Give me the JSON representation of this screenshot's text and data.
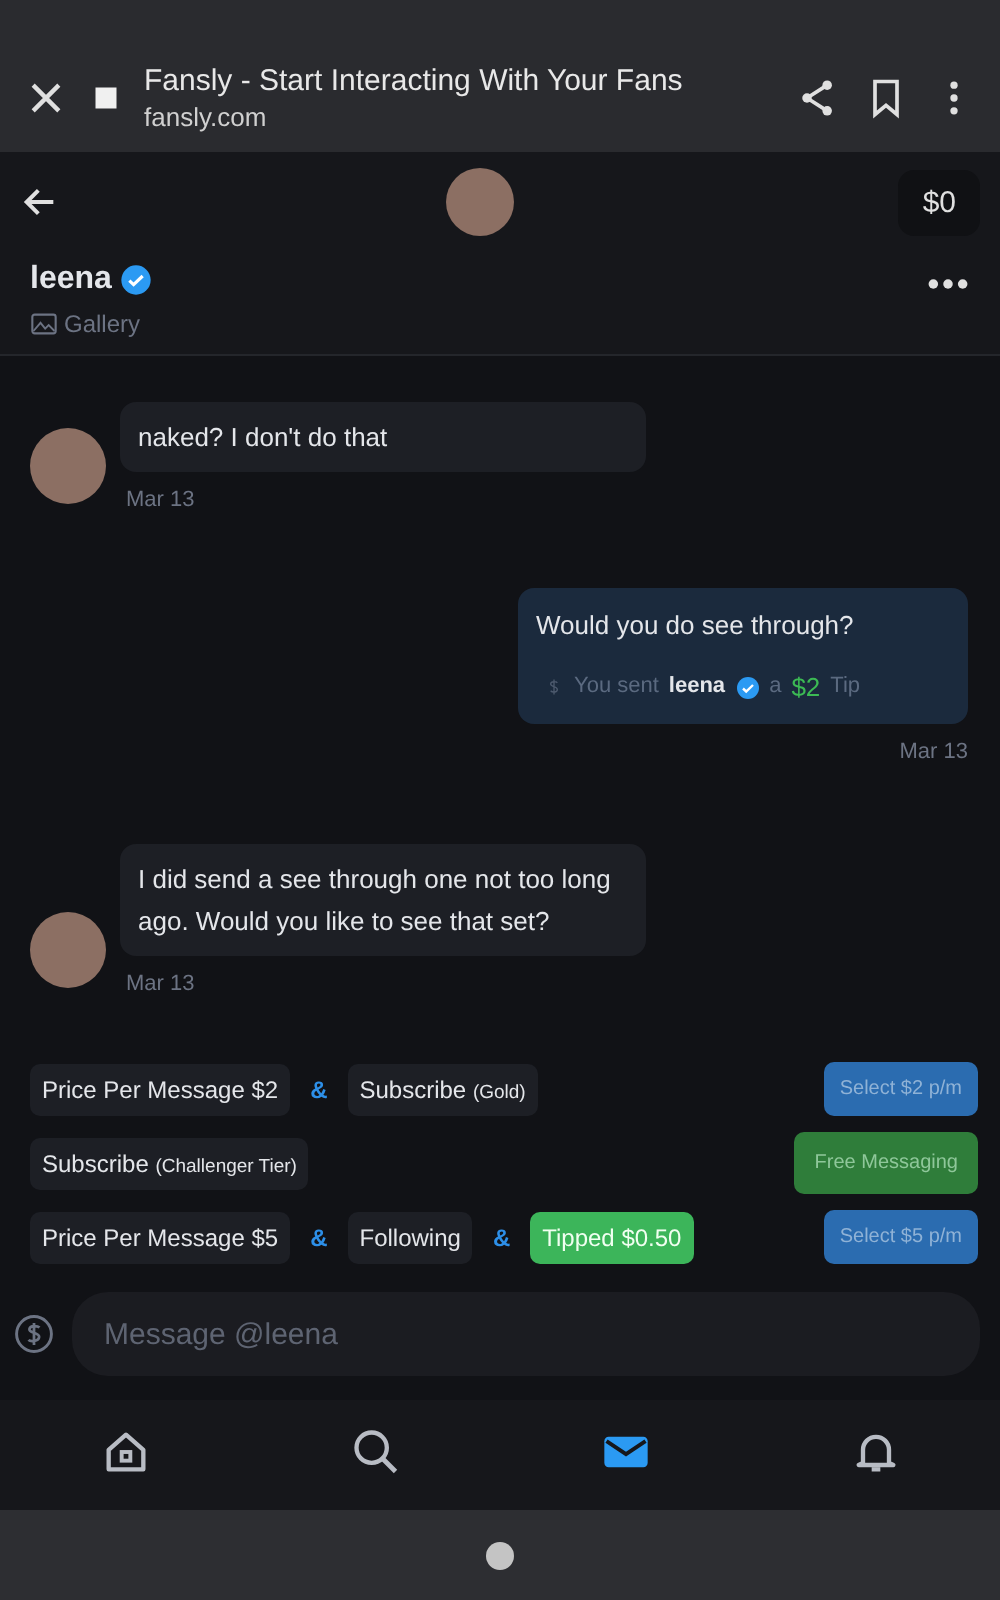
{
  "browser": {
    "title": "Fansly - Start Interacting With Your Fans",
    "url": "fansly.com"
  },
  "header": {
    "balance": "$0",
    "name": "leena",
    "verified": true,
    "gallery": "Gallery"
  },
  "messages": [
    {
      "kind": "incoming",
      "text": "naked? I don't do that",
      "date": "Mar 13"
    },
    {
      "kind": "outgoing",
      "text": "Would you do see through?",
      "tip": {
        "prefix": "You sent",
        "recipient": "leena",
        "joiner": "a",
        "amount": "$2",
        "suffix": "Tip"
      },
      "date": "Mar 13"
    },
    {
      "kind": "incoming",
      "text": "I did send a see through one not too long ago. Would you like to see that set?",
      "date": "Mar 13"
    }
  ],
  "tiers": [
    {
      "items": [
        {
          "kind": "chip",
          "label": "Price Per Message $2"
        },
        {
          "kind": "joiner",
          "label": "&"
        },
        {
          "kind": "chip",
          "label": "Subscribe",
          "note": "(Gold)"
        }
      ],
      "action": {
        "label": "Select $2 p/m",
        "color": "#2b6cb0"
      }
    },
    {
      "items": [
        {
          "kind": "chip",
          "label": "Subscribe",
          "note": "(Challenger Tier)"
        }
      ],
      "action": {
        "label": "Free Messaging",
        "color": "#2f7d3a"
      }
    },
    {
      "items": [
        {
          "kind": "chip",
          "label": "Price Per Message $5"
        },
        {
          "kind": "joiner",
          "label": "&"
        },
        {
          "kind": "chip",
          "label": "Following"
        },
        {
          "kind": "joiner",
          "label": "&"
        },
        {
          "kind": "highlight",
          "label": "Tipped $0.50"
        }
      ],
      "action": {
        "label": "Select $5 p/m",
        "color": "#2b6cb0"
      }
    }
  ],
  "composer": {
    "placeholder": "Message @leena"
  },
  "nav": [
    {
      "kind": "home",
      "selected": false
    },
    {
      "kind": "search",
      "selected": false
    },
    {
      "kind": "messages",
      "selected": true
    },
    {
      "kind": "notifications",
      "selected": false
    }
  ]
}
